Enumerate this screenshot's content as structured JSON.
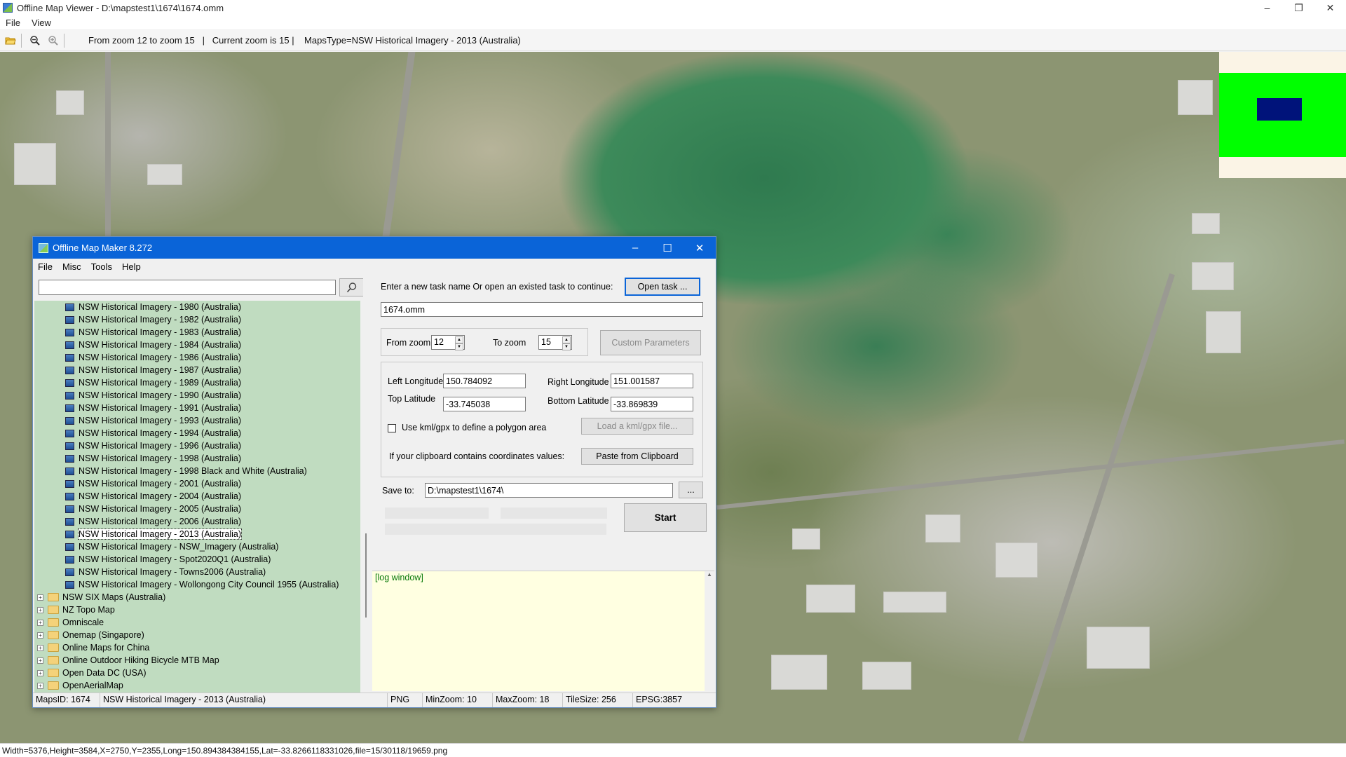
{
  "window": {
    "title": "Offline Map Viewer - D:\\mapstest1\\1674\\1674.omm",
    "controls": {
      "minimize": "–",
      "maximize": "❐",
      "close": "✕"
    }
  },
  "menu": {
    "file": "File",
    "view": "View"
  },
  "toolbar": {
    "info": "From zoom 12 to zoom 15   |   Current zoom is 15 |    MapsType=NSW Historical Imagery - 2013 (Australia)"
  },
  "status": {
    "text": "Width=5376,Height=3584,X=2750,Y=2355,Long=150.894384384155,Lat=-33.8266118331026,file=15/30118/19659.png"
  },
  "dialog": {
    "title": "Offline Map Maker 8.272",
    "controls": {
      "minimize": "–",
      "maximize": "☐",
      "close": "✕"
    },
    "menu": {
      "file": "File",
      "misc": "Misc",
      "tools": "Tools",
      "help": "Help"
    },
    "search": {
      "value": "",
      "placeholder": ""
    },
    "tree": {
      "children": [
        "NSW Historical Imagery - 1980 (Australia)",
        "NSW Historical Imagery - 1982 (Australia)",
        "NSW Historical Imagery - 1983 (Australia)",
        "NSW Historical Imagery - 1984 (Australia)",
        "NSW Historical Imagery - 1986 (Australia)",
        "NSW Historical Imagery - 1987 (Australia)",
        "NSW Historical Imagery - 1989 (Australia)",
        "NSW Historical Imagery - 1990 (Australia)",
        "NSW Historical Imagery - 1991 (Australia)",
        "NSW Historical Imagery - 1993 (Australia)",
        "NSW Historical Imagery - 1994 (Australia)",
        "NSW Historical Imagery - 1996 (Australia)",
        "NSW Historical Imagery - 1998 (Australia)",
        "NSW Historical Imagery - 1998 Black and White (Australia)",
        "NSW Historical Imagery - 2001 (Australia)",
        "NSW Historical Imagery - 2004 (Australia)",
        "NSW Historical Imagery - 2005 (Australia)",
        "NSW Historical Imagery - 2006 (Australia)",
        "NSW Historical Imagery - 2013 (Australia)",
        "NSW Historical Imagery - NSW_Imagery (Australia)",
        "NSW Historical Imagery - Spot2020Q1 (Australia)",
        "NSW Historical Imagery - Towns2006 (Australia)",
        "NSW Historical Imagery - Wollongong City Council 1955 (Australia)"
      ],
      "folders": [
        "NSW SIX Maps (Australia)",
        "NZ Topo Map",
        "Omniscale",
        "Onemap (Singapore)",
        "Online Maps for China",
        "Online Outdoor Hiking Bicycle MTB Map",
        "Open Data DC (USA)",
        "OpenAerialMap"
      ],
      "selected": "NSW Historical Imagery - 2013 (Australia)"
    },
    "task": {
      "prompt": "Enter a new task name Or open an existed task to continue:",
      "open_button": "Open task ...",
      "name_value": "1674.omm"
    },
    "zoom": {
      "from_label": "From zoom",
      "from_value": "12",
      "to_label": "To zoom",
      "to_value": "15",
      "custom_button": "Custom Parameters"
    },
    "coords": {
      "left_lon_label": "Left Longitude",
      "left_lon_value": "150.784092",
      "right_lon_label": "Right Longitude",
      "right_lon_value": "151.001587",
      "top_lat_label": "Top Latitude",
      "top_lat_value": "-33.745038",
      "bottom_lat_label": "Bottom Latitude",
      "bottom_lat_value": "-33.869839",
      "kml_label": "Use kml/gpx to define a polygon area",
      "kml_button": "Load a kml/gpx file...",
      "clipboard_label": "If your clipboard contains coordinates values:",
      "clipboard_button": "Paste from Clipboard"
    },
    "save": {
      "label": "Save to:",
      "value": "D:\\mapstest1\\1674\\",
      "browse_button": "..."
    },
    "start_button": "Start",
    "log": {
      "text": "[log window]"
    },
    "statusbar": {
      "maps_id": "MapsID: 1674",
      "maps_name": "NSW Historical Imagery - 2013 (Australia)",
      "format": "PNG",
      "min_zoom": "MinZoom: 10",
      "max_zoom": "MaxZoom: 18",
      "tile_size": "TileSize: 256",
      "epsg": "EPSG:3857"
    }
  }
}
